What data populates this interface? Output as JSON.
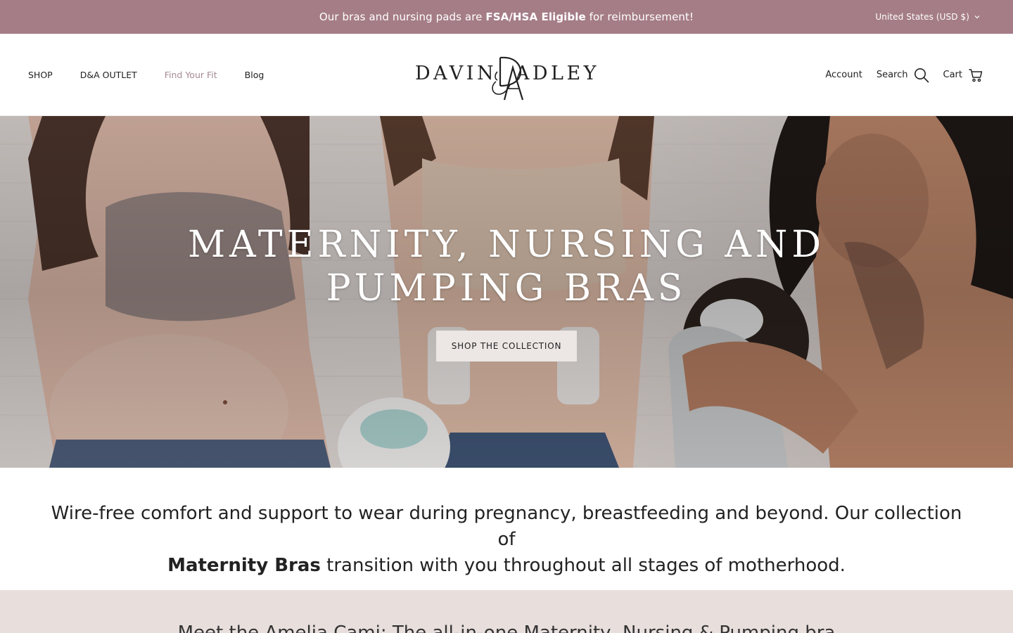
{
  "announcement": {
    "prefix": "Our bras and nursing pads are ",
    "highlight": "FSA/HSA Eligible",
    "suffix": " for reimbursement!"
  },
  "currency_selector": {
    "label": "United States (USD $)",
    "icon": "chevron-down-icon"
  },
  "nav": {
    "items": [
      {
        "label": "SHOP"
      },
      {
        "label": "D&A OUTLET"
      },
      {
        "label": "Find Your Fit"
      },
      {
        "label": "Blog"
      }
    ]
  },
  "logo": {
    "left": "DAVIN",
    "right": "ADLEY",
    "monogram": "DA"
  },
  "header_actions": {
    "account": "Account",
    "search": "Search",
    "search_icon": "search-icon",
    "cart": "Cart",
    "cart_icon": "cart-icon"
  },
  "hero": {
    "title_line1": "MATERNITY, NURSING AND",
    "title_line2": "PUMPING BRAS",
    "button": "SHOP THE COLLECTION"
  },
  "intro": {
    "line1": "Wire-free comfort and support to wear during pregnancy, breastfeeding and beyond. Our collection of",
    "bold": "Maternity Bras",
    "line2_rest": " transition with you throughout all stages of motherhood."
  },
  "band": {
    "text": "Meet the Amelia Cami: The all-in-one Maternity, Nursing & Pumping bra"
  },
  "colors": {
    "announcement_bg": "#a57d87",
    "nav_muted": "#a58a92",
    "band_bg": "#e8dfdd",
    "button_bg": "#ece6e5"
  }
}
